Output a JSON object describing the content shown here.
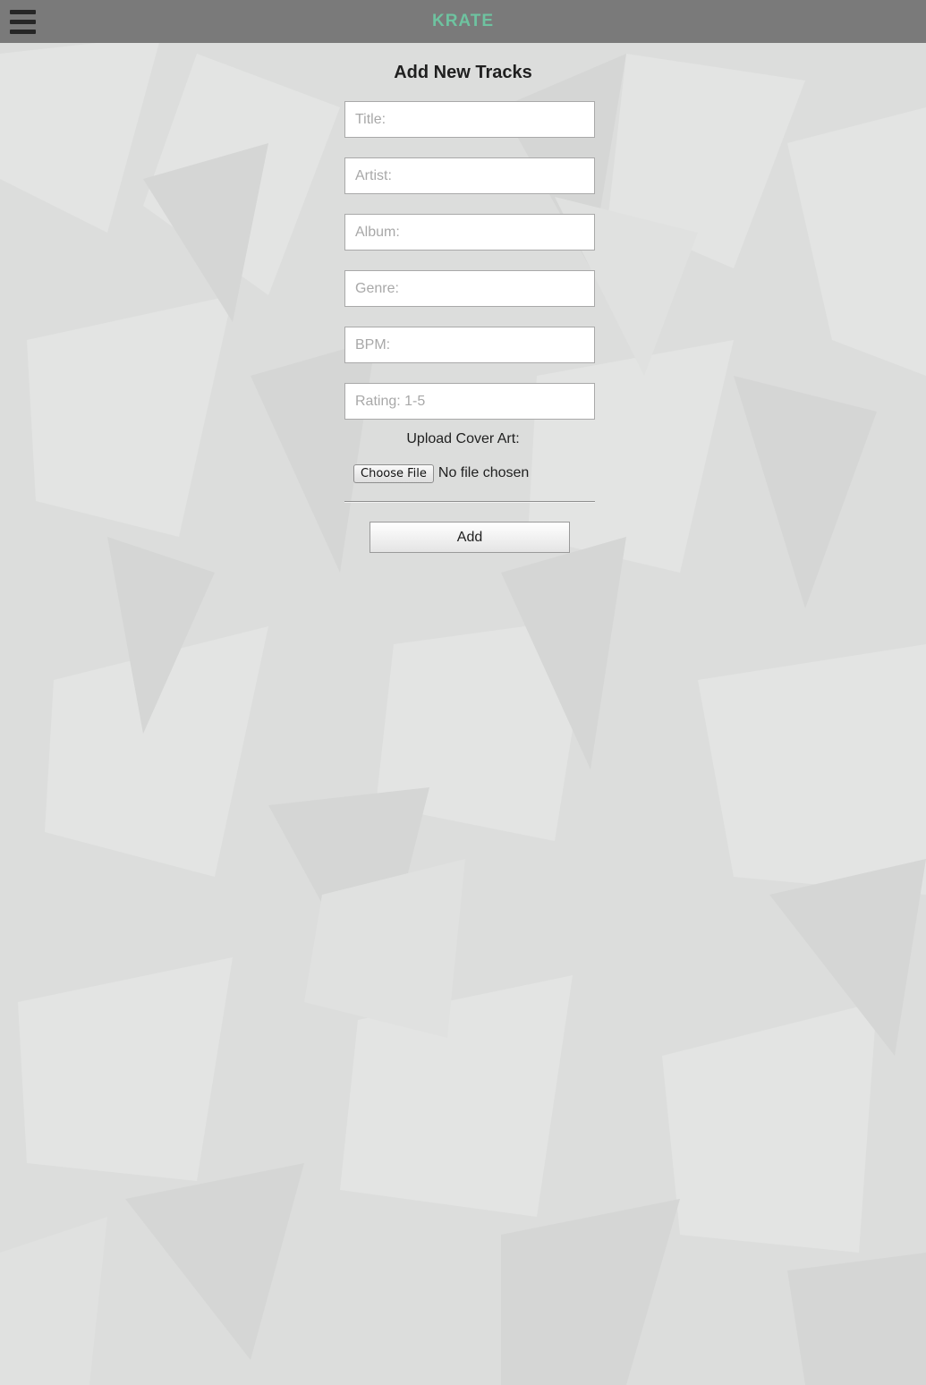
{
  "header": {
    "brand": "KRATE",
    "menu_icon": "hamburger-menu-icon",
    "brand_color": "#6ec3a0",
    "bar_color": "#7a7a7a"
  },
  "form": {
    "title": "Add New Tracks",
    "fields": {
      "title": "Title:",
      "artist": "Artist:",
      "album": "Album:",
      "genre": "Genre:",
      "bpm": "BPM:",
      "rating": "Rating: 1-5"
    },
    "upload_label": "Upload Cover Art:",
    "choose_file_label": "Choose File",
    "file_status": "No file chosen",
    "submit_label": "Add"
  }
}
